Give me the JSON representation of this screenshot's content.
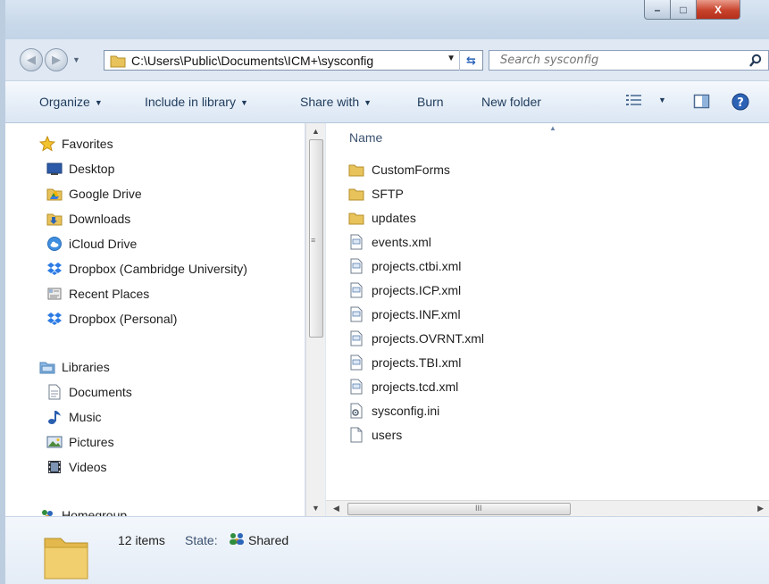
{
  "window": {
    "buttons": {
      "minimize": "–",
      "maximize": "□",
      "close": "X"
    }
  },
  "address": {
    "path": "C:\\Users\\Public\\Documents\\ICM+\\sysconfig",
    "search_placeholder": "Search sysconfig"
  },
  "toolbar": {
    "organize": "Organize",
    "include_in_library": "Include in library",
    "share_with": "Share with",
    "burn": "Burn",
    "new_folder": "New folder"
  },
  "sidebar": {
    "favorites": {
      "label": "Favorites",
      "items": [
        {
          "label": "Desktop",
          "icon": "desktop-icon"
        },
        {
          "label": "Google Drive",
          "icon": "google-drive-icon"
        },
        {
          "label": "Downloads",
          "icon": "downloads-icon"
        },
        {
          "label": "iCloud Drive",
          "icon": "icloud-icon"
        },
        {
          "label": "Dropbox (Cambridge University)",
          "icon": "dropbox-icon"
        },
        {
          "label": "Recent Places",
          "icon": "recent-places-icon"
        },
        {
          "label": "Dropbox (Personal)",
          "icon": "dropbox-icon"
        }
      ]
    },
    "libraries": {
      "label": "Libraries",
      "items": [
        {
          "label": "Documents",
          "icon": "documents-icon"
        },
        {
          "label": "Music",
          "icon": "music-icon"
        },
        {
          "label": "Pictures",
          "icon": "pictures-icon"
        },
        {
          "label": "Videos",
          "icon": "videos-icon"
        }
      ]
    },
    "homegroup": {
      "label": "Homegroup"
    }
  },
  "filelist": {
    "column_name": "Name",
    "files": [
      {
        "name": "CustomForms",
        "type": "folder"
      },
      {
        "name": "SFTP",
        "type": "folder"
      },
      {
        "name": "updates",
        "type": "folder"
      },
      {
        "name": "events.xml",
        "type": "xml"
      },
      {
        "name": "projects.ctbi.xml",
        "type": "xml"
      },
      {
        "name": "projects.ICP.xml",
        "type": "xml"
      },
      {
        "name": "projects.INF.xml",
        "type": "xml"
      },
      {
        "name": "projects.OVRNT.xml",
        "type": "xml"
      },
      {
        "name": "projects.TBI.xml",
        "type": "xml"
      },
      {
        "name": "projects.tcd.xml",
        "type": "xml"
      },
      {
        "name": "sysconfig.ini",
        "type": "ini"
      },
      {
        "name": "users",
        "type": "file"
      }
    ]
  },
  "details": {
    "item_count": "12 items",
    "state_label": "State:",
    "state_value": "Shared"
  },
  "colors": {
    "accent": "#1e3b5c",
    "folder": "#e8c25a",
    "close_button": "#c8432c"
  }
}
